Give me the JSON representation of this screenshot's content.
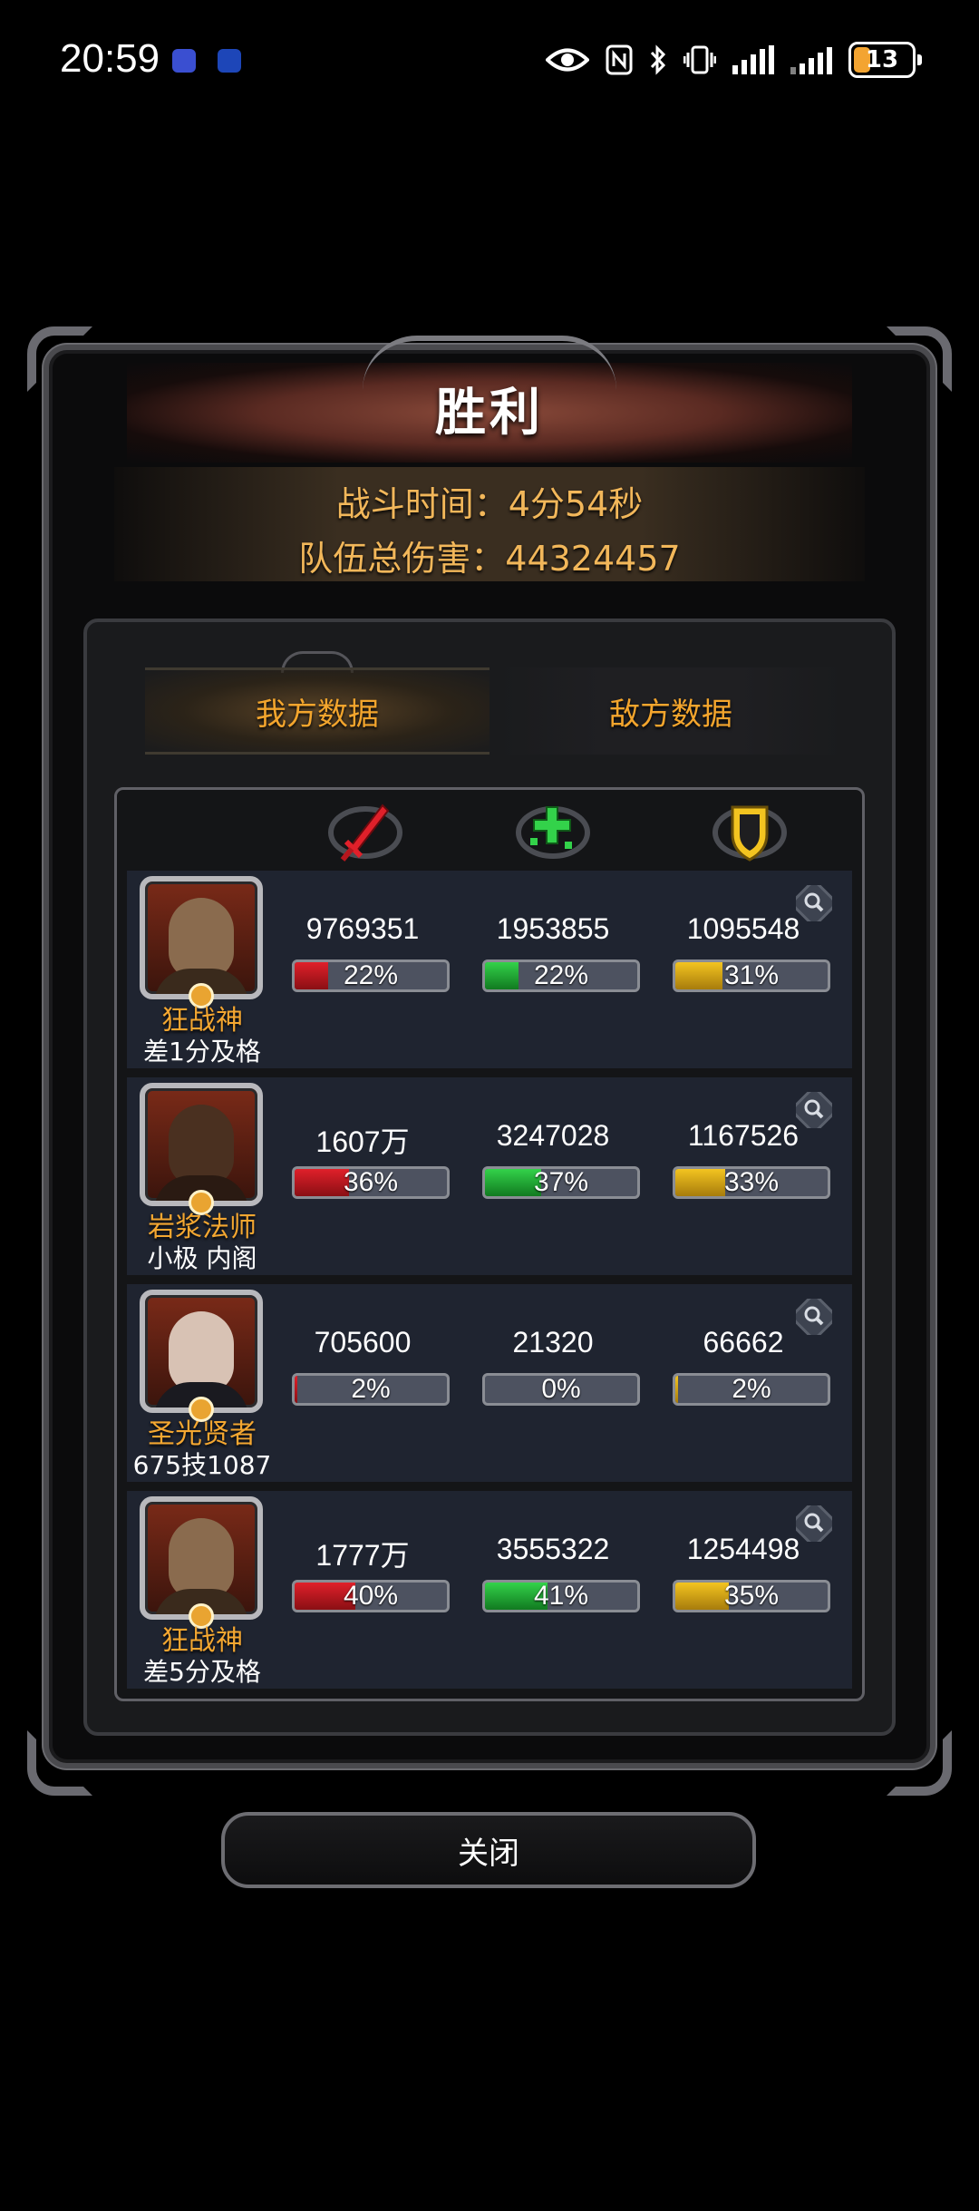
{
  "status_bar": {
    "time": "20:59",
    "battery": "13",
    "accent_battery": "#f3a431"
  },
  "dialog": {
    "title": "胜利",
    "battle_time": "战斗时间：4分54秒",
    "team_damage": "队伍总伤害：44324457",
    "tabs": [
      {
        "label": "我方数据",
        "active": true
      },
      {
        "label": "敌方数据",
        "active": false
      }
    ],
    "columns": [
      {
        "icon": "sword-icon",
        "color": "#e0202a"
      },
      {
        "icon": "heal-cross-icon",
        "color": "#33d24a"
      },
      {
        "icon": "shield-icon",
        "color": "#f3c420"
      }
    ],
    "heroes": [
      {
        "name": "狂战神",
        "sub": "差1分及格",
        "damage": "9769351",
        "damage_pct": "22%",
        "damage_fill": 0.22,
        "heal": "1953855",
        "heal_pct": "22%",
        "heal_fill": 0.22,
        "tank": "1095548",
        "tank_pct": "31%",
        "tank_fill": 0.31
      },
      {
        "name": "岩浆法师",
        "sub": "小极 内阁",
        "damage": "1607万",
        "damage_pct": "36%",
        "damage_fill": 0.36,
        "heal": "3247028",
        "heal_pct": "37%",
        "heal_fill": 0.37,
        "tank": "1167526",
        "tank_pct": "33%",
        "tank_fill": 0.33
      },
      {
        "name": "圣光贤者",
        "sub": "675技1087",
        "damage": "705600",
        "damage_pct": "2%",
        "damage_fill": 0.02,
        "heal": "21320",
        "heal_pct": "0%",
        "heal_fill": 0.0,
        "tank": "66662",
        "tank_pct": "2%",
        "tank_fill": 0.02
      },
      {
        "name": "狂战神",
        "sub": "差5分及格",
        "damage": "1777万",
        "damage_pct": "40%",
        "damage_fill": 0.4,
        "heal": "3555322",
        "heal_pct": "41%",
        "heal_fill": 0.41,
        "tank": "1254498",
        "tank_pct": "35%",
        "tank_fill": 0.35
      }
    ],
    "close_label": "关闭"
  }
}
